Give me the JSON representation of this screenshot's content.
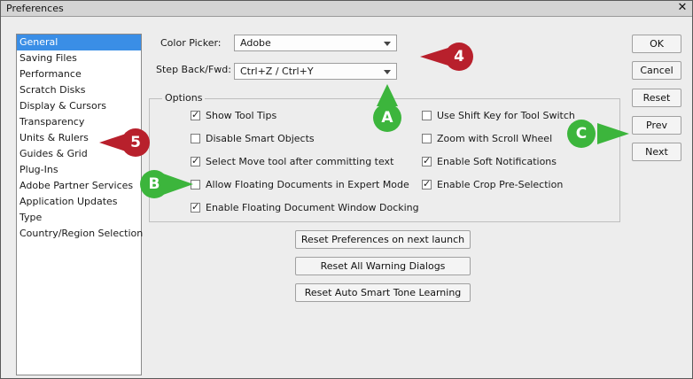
{
  "window": {
    "title": "Preferences",
    "close_glyph": "✕"
  },
  "sidebar": {
    "items": [
      {
        "label": "General",
        "selected": true
      },
      {
        "label": "Saving Files"
      },
      {
        "label": "Performance"
      },
      {
        "label": "Scratch Disks"
      },
      {
        "label": "Display & Cursors"
      },
      {
        "label": "Transparency"
      },
      {
        "label": "Units & Rulers"
      },
      {
        "label": "Guides & Grid"
      },
      {
        "label": "Plug-Ins"
      },
      {
        "label": "Adobe Partner Services"
      },
      {
        "label": "Application Updates"
      },
      {
        "label": "Type"
      },
      {
        "label": "Country/Region Selection"
      }
    ]
  },
  "fields": {
    "color_picker": {
      "label": "Color Picker:",
      "value": "Adobe"
    },
    "step_back": {
      "label": "Step Back/Fwd:",
      "value": "Ctrl+Z / Ctrl+Y"
    }
  },
  "options": {
    "title": "Options",
    "left": [
      {
        "label": "Show Tool Tips",
        "checked": true
      },
      {
        "label": "Disable Smart Objects",
        "checked": false
      },
      {
        "label": "Select Move tool after committing text",
        "checked": true
      },
      {
        "label": "Allow Floating Documents in Expert Mode",
        "checked": false
      },
      {
        "label": "Enable Floating Document Window Docking",
        "checked": true
      }
    ],
    "right": [
      {
        "label": "Use Shift Key for Tool Switch",
        "checked": false
      },
      {
        "label": "Zoom with Scroll Wheel",
        "checked": false
      },
      {
        "label": "Enable Soft Notifications",
        "checked": true
      },
      {
        "label": "Enable Crop Pre-Selection",
        "checked": true
      }
    ]
  },
  "reset_buttons": {
    "preferences": "Reset Preferences on next launch",
    "warnings": "Reset All Warning Dialogs",
    "smart_tone": "Reset Auto Smart Tone Learning"
  },
  "side_buttons": {
    "ok": "OK",
    "cancel": "Cancel",
    "reset": "Reset",
    "prev": "Prev",
    "next": "Next"
  },
  "callouts": {
    "four": "4",
    "five": "5",
    "a": "A",
    "b": "B",
    "c": "C",
    "red_color": "#b8202c",
    "green_color": "#3cb53c"
  }
}
